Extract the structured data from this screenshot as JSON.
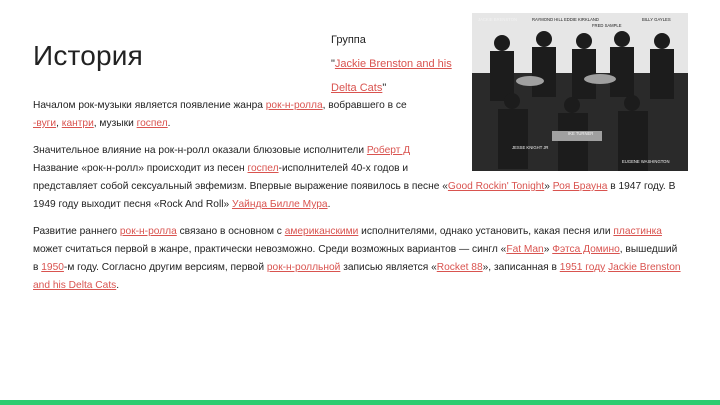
{
  "slide": {
    "title": "История",
    "caption": {
      "line1": "Группа",
      "open_quote": "\"",
      "link": "Jackie Brenston and his Delta Cats",
      "close_quote": "\""
    },
    "photo_labels": [
      "JACKIE BRENSTON",
      "RAYMOND HILL",
      "EDDIE KIRKLAND",
      "FRED SAMPLE",
      "BILLY GAYLES",
      "JESSE KNIGHT JR",
      "IKE TURNER",
      "EUGENE WASHINGTON"
    ],
    "p1": {
      "t1": "Началом рок-музыки является появление жанра ",
      "l1": "рок-н-ролла",
      "t2": ", вобравшего в се",
      "l2": "-вуги",
      "t3": ", ",
      "l3": "кантри",
      "t4": ", музыки ",
      "l4": "госпел",
      "t5": "."
    },
    "p2": {
      "t1": "Значительное влияние на рок-н-ролл оказали блюзовые исполнители ",
      "l1": "Роберт Д",
      "t2": "Название «рок-н-ролл» происходит из песен ",
      "l2": "госпел",
      "t3": "-исполнителей 40-х годов и",
      "t4": "представляет собой сексуальный эвфемизм. Впервые выражение появилось в песне «",
      "l3": "Good Rockin' Tonight",
      "t5": "» ",
      "l4": "Роя Брауна",
      "t6": " в 1947 году. В 1949 году выходит песня «Rock And Roll» ",
      "l5": "Уайнда Билле Мура",
      "t7": "."
    },
    "p3": {
      "t1": "Развитие раннего ",
      "l1": "рок-н-ролла",
      "t2": " связано в основном с ",
      "l2": "американскими",
      "t3": " исполнителями, однако установить, какая песня или ",
      "l3": "пластинка",
      "t4": " может считаться первой в жанре, практически невозможно. Среди возможных вариантов — сингл «",
      "l4": "Fat Man",
      "t5": "» ",
      "l5": "Фэтса Домино",
      "t6": ", вышедший в ",
      "l6": "1950",
      "t7": "-м году. Согласно другим версиям, первой ",
      "l7": "рок-н-ролльной",
      "t8": " записью является «",
      "l8": "Rocket 88",
      "t9": "», записанная в ",
      "l9": "1951 году",
      "t10": " ",
      "l10": "Jackie Brenston and his Delta Cats",
      "t11": "."
    }
  },
  "colors": {
    "link": "#d9534f",
    "accent_bar": "#2ecc71"
  }
}
